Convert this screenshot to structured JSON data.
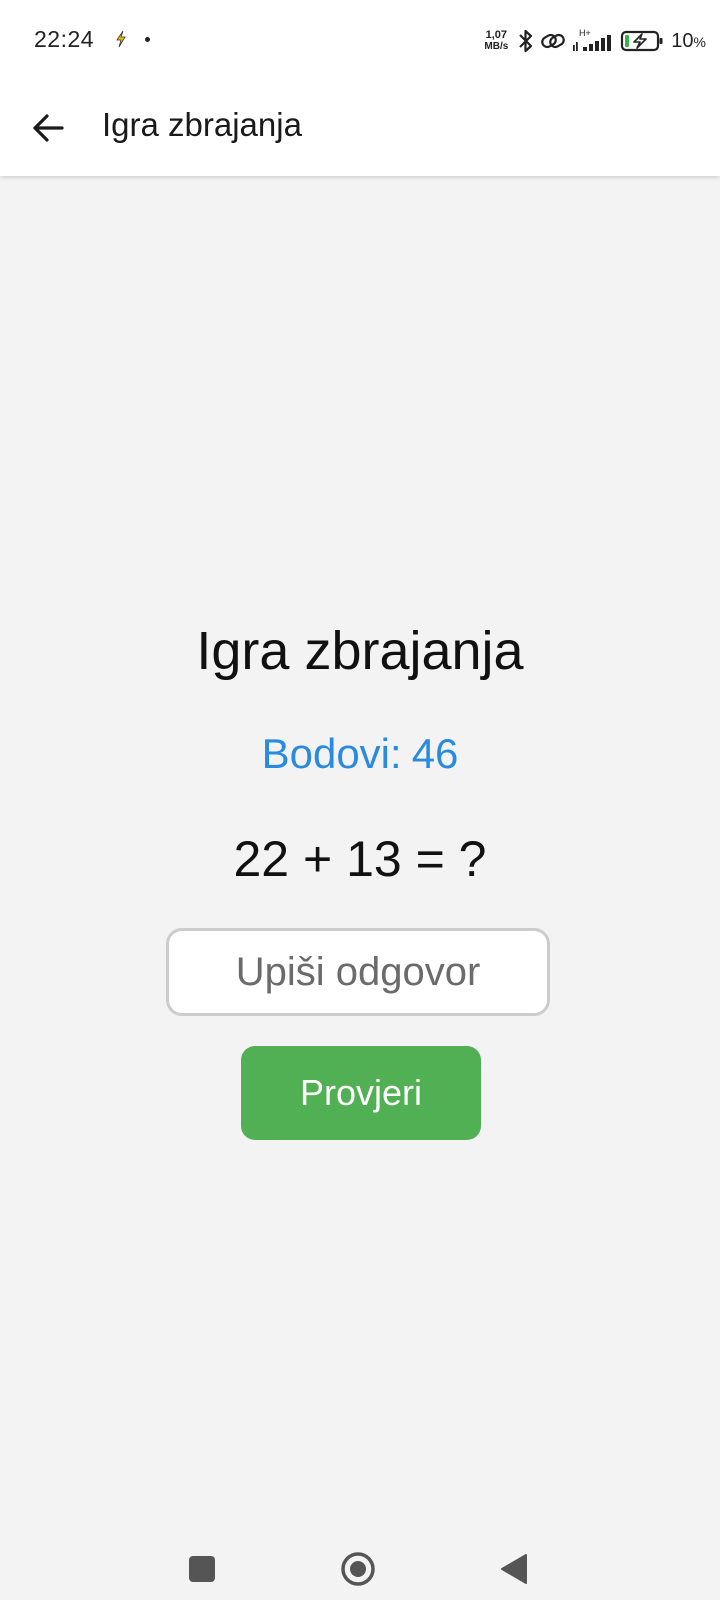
{
  "status_bar": {
    "time": "22:24",
    "net_speed_value": "1,07",
    "net_speed_unit": "MB/s",
    "network_type": "H+",
    "battery_percent": "10",
    "battery_percent_sign": "%",
    "icons": [
      "flash-notification-icon",
      "bluetooth-icon",
      "link-icon",
      "signal-icon",
      "battery-charging-icon"
    ]
  },
  "app_bar": {
    "title": "Igra zbrajanja",
    "back_icon": "arrow-back-icon"
  },
  "game": {
    "title": "Igra zbrajanja",
    "score_label": "Bodovi:",
    "score_value": "46",
    "question": "22 + 13 = ?",
    "answer_placeholder": "Upiši odgovor",
    "answer_value": "",
    "check_label": "Provjeri"
  },
  "colors": {
    "score": "#2a8ae0",
    "button": "#50b053",
    "background": "#f3f3f3"
  },
  "nav_bar": {
    "icons": [
      "recents-icon",
      "home-icon",
      "back-icon"
    ]
  }
}
